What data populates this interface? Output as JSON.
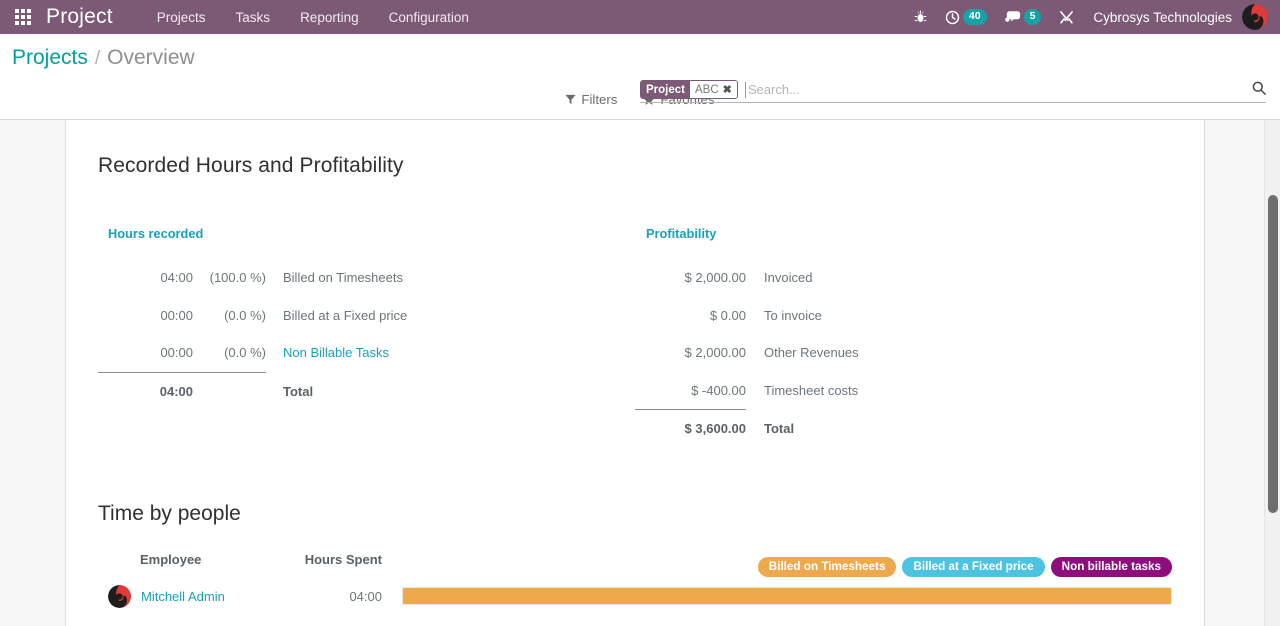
{
  "navbar": {
    "apps_icon": "apps-grid-icon",
    "brand": "Project",
    "menu": [
      {
        "label": "Projects"
      },
      {
        "label": "Tasks"
      },
      {
        "label": "Reporting"
      },
      {
        "label": "Configuration"
      }
    ],
    "right": {
      "bug_icon": "bug-icon",
      "activities_icon": "clock-icon",
      "activities_count": "40",
      "messages_icon": "chat-bubble-icon",
      "messages_count": "5",
      "tools_icon": "wrench-icon",
      "company": "Cybrosys Technologies",
      "avatar_icon": "user-avatar"
    },
    "colors": {
      "background": "#7c5a75",
      "badge": "#17a2a6"
    }
  },
  "control_panel": {
    "breadcrumb": {
      "root": "Projects",
      "separator": "/",
      "current": "Overview"
    },
    "search": {
      "facet_label": "Project",
      "facet_value": "ABC",
      "facet_remove_icon": "close-icon",
      "placeholder": "Search...",
      "value": "",
      "magnifier_icon": "search-icon"
    },
    "buttons": [
      {
        "label": "Filters",
        "icon": "filter-funnel-icon"
      },
      {
        "label": "Favorites",
        "icon": "star-icon"
      }
    ]
  },
  "main": {
    "recorded_section": {
      "title": "Recorded Hours and Profitability",
      "hours": {
        "heading": "Hours recorded",
        "rows": [
          {
            "value": "04:00",
            "percent": "(100.0 %)",
            "label": "Billed on Timesheets",
            "link": false
          },
          {
            "value": "00:00",
            "percent": "(0.0 %)",
            "label": "Billed at a Fixed price",
            "link": false
          },
          {
            "value": "00:00",
            "percent": "(0.0 %)",
            "label": "Non Billable Tasks",
            "link": true
          }
        ],
        "total": {
          "value": "04:00",
          "label": "Total"
        }
      },
      "profitability": {
        "heading": "Profitability",
        "rows": [
          {
            "value": "$ 2,000.00",
            "label": "Invoiced"
          },
          {
            "value": "$ 0.00",
            "label": "To invoice"
          },
          {
            "value": "$ 2,000.00",
            "label": "Other Revenues"
          },
          {
            "value": "$ -400.00",
            "label": "Timesheet costs"
          }
        ],
        "total": {
          "value": "$ 3,600.00",
          "label": "Total"
        }
      }
    },
    "time_by_people": {
      "title": "Time by people",
      "legend": [
        {
          "label": "Billed on Timesheets",
          "color": "#eda94b"
        },
        {
          "label": "Billed at a Fixed price",
          "color": "#4cc3e0"
        },
        {
          "label": "Non billable tasks",
          "color": "#8e0e7e"
        }
      ],
      "columns": {
        "employee": "Employee",
        "hours_spent": "Hours Spent"
      },
      "rows": [
        {
          "employee": "Mitchell Admin",
          "hours_spent": "04:00",
          "bar_percent": 100,
          "bar_color": "#eda94b",
          "avatar_icon": "user-avatar"
        }
      ]
    }
  },
  "chart_data": {
    "type": "bar",
    "title": "Time by people",
    "categories": [
      "Mitchell Admin"
    ],
    "series": [
      {
        "name": "Billed on Timesheets",
        "values": [
          100
        ],
        "color": "#eda94b"
      },
      {
        "name": "Billed at a Fixed price",
        "values": [
          0
        ],
        "color": "#4cc3e0"
      },
      {
        "name": "Non billable tasks",
        "values": [
          0
        ],
        "color": "#8e0e7e"
      }
    ],
    "xlabel": "",
    "ylabel": "Hours Spent",
    "legend_position": "top-right",
    "grid": false,
    "annotations": [
      "Mitchell Admin: 04:00"
    ]
  }
}
